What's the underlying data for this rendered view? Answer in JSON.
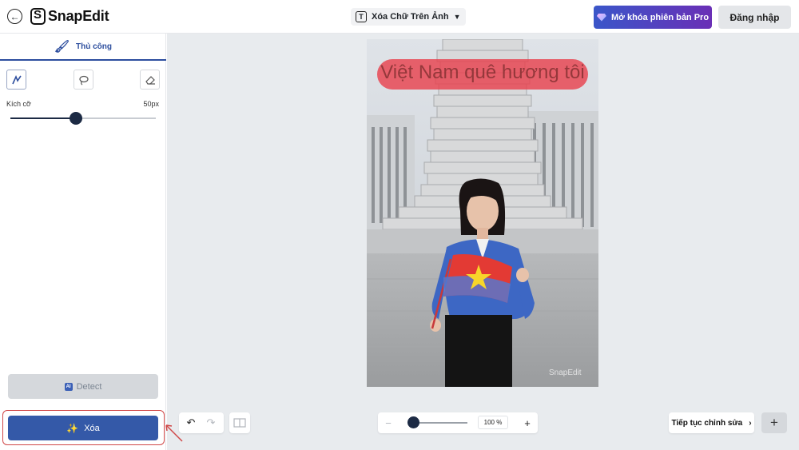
{
  "header": {
    "app_name": "SnapEdit",
    "tool_name": "Xóa Chữ Trên Ảnh",
    "pro_label": "Mở khóa phiên bản Pro",
    "login_label": "Đăng nhập"
  },
  "sidebar": {
    "mode_label": "Thủ công",
    "tools": [
      "brush-icon",
      "lasso-icon",
      "eraser-icon"
    ],
    "size_label": "Kích cỡ",
    "size_value": "50px",
    "size_fraction": 0.45,
    "detect_label": "Detect",
    "detect_badge": "AI",
    "erase_label": "Xóa"
  },
  "canvas": {
    "overlay_text": "Việt Nam quê hương tôi",
    "watermark": "SnapEdit",
    "zoom_value": "100 %",
    "zoom_fraction": 0.05,
    "continue_label": "Tiếp tục chỉnh sửa"
  },
  "colors": {
    "primary": "#3459a8",
    "pro_gradient_start": "#3a56c9",
    "pro_gradient_end": "#6a2fb6",
    "mask_red": "#e8424e",
    "highlight_outline": "#d04848"
  }
}
